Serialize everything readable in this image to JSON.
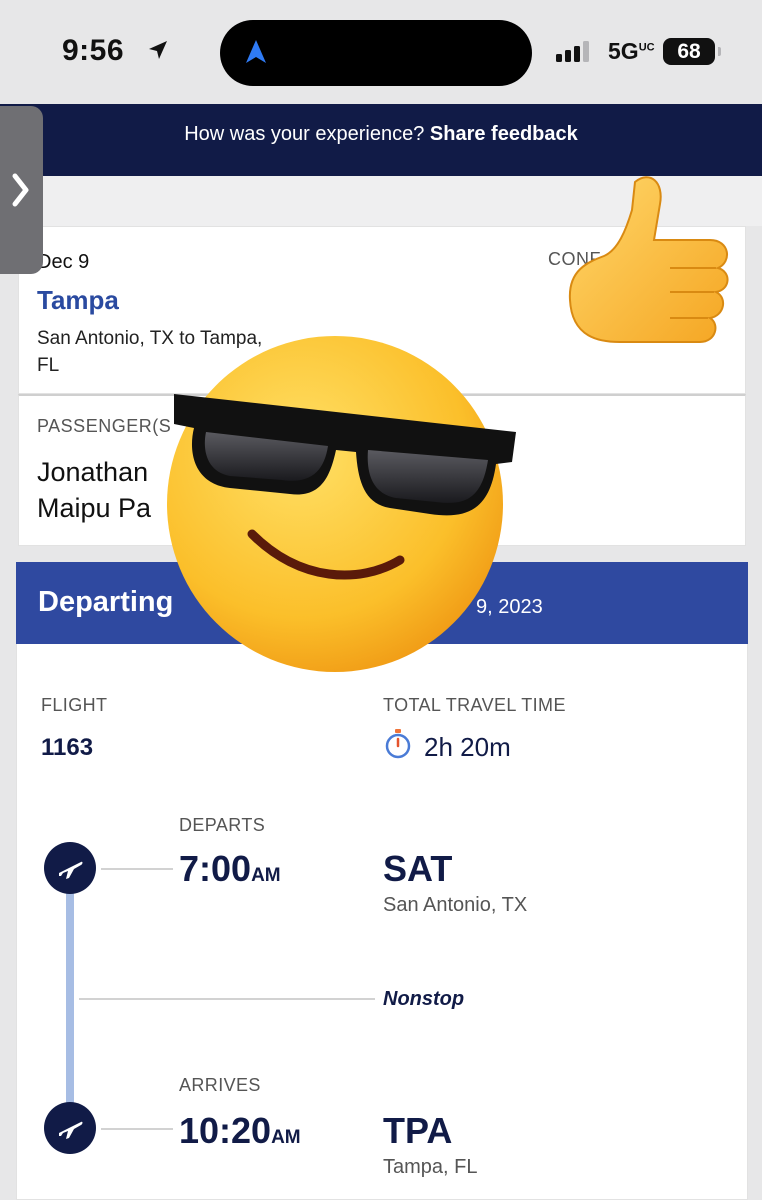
{
  "status": {
    "time": "9:56",
    "network": "5G",
    "network_suffix": "UC",
    "battery": "68"
  },
  "banner": {
    "prompt": "How was your experience?",
    "link": "Share feedback"
  },
  "trip": {
    "date": "Dec 9",
    "city": "Tampa",
    "route": "San Antonio, TX to Tampa, FL",
    "confirmation_label": "CONF"
  },
  "passengers": {
    "label": "PASSENGER(S",
    "name": "Jonathan\nMaipu Pa"
  },
  "departing": {
    "title": "Departing",
    "date_partial": "9, 2023"
  },
  "flight": {
    "flight_label": "FLIGHT",
    "flight_number": "1163",
    "travel_time_label": "TOTAL TRAVEL TIME",
    "travel_time": "2h 20m",
    "departs_label": "DEPARTS",
    "departs_time": "7:00",
    "departs_ampm": "AM",
    "origin_code": "SAT",
    "origin_city": "San Antonio, TX",
    "stops": "Nonstop",
    "arrives_label": "ARRIVES",
    "arrives_time": "10:20",
    "arrives_ampm": "AM",
    "dest_code": "TPA",
    "dest_city": "Tampa, FL"
  },
  "colors": {
    "navy": "#111b47",
    "brand_blue": "#2f49a0",
    "timeline": "#a7bde4"
  },
  "icons": [
    "location-arrow-icon",
    "navigation-icon",
    "signal-icon",
    "battery-icon",
    "chevron-right-icon",
    "stopwatch-icon",
    "plane-icon",
    "thumbs-up-emoji",
    "sunglasses-emoji"
  ]
}
